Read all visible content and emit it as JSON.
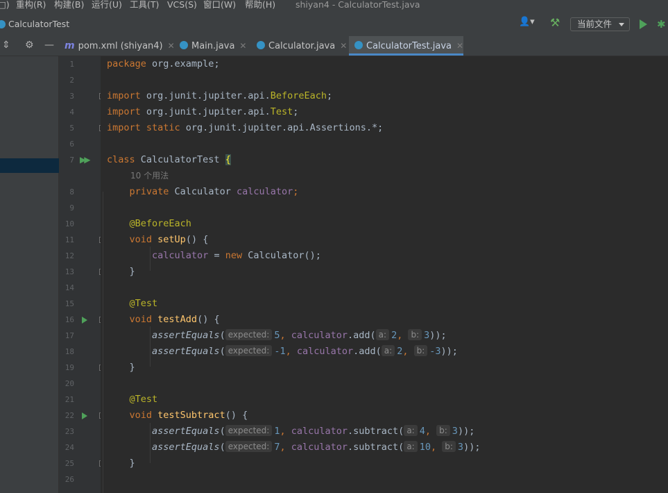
{
  "menubar": {
    "items": [
      "□)",
      "重构(R)",
      "构建(B)",
      "运行(U)",
      "工具(T)",
      "VCS(S)",
      "窗口(W)",
      "帮助(H)"
    ],
    "window_title": "shiyan4 - CalculatorTest.java"
  },
  "navbar": {
    "breadcrumb": "CalculatorTest",
    "run_config": "当前文件"
  },
  "tabs": [
    {
      "label": "pom.xml (shiyan4)",
      "icon": "maven-icon"
    },
    {
      "label": "Main.java",
      "icon": "java-class-icon"
    },
    {
      "label": "Calculator.java",
      "icon": "java-class-icon"
    },
    {
      "label": "CalculatorTest.java",
      "icon": "java-class-icon",
      "active": true
    }
  ],
  "gutter": {
    "line_numbers": [
      "1",
      "2",
      "3",
      "4",
      "5",
      "6",
      "7",
      "8",
      "9",
      "10",
      "11",
      "12",
      "13",
      "14",
      "15",
      "16",
      "17",
      "18",
      "19",
      "20",
      "21",
      "22",
      "23",
      "24",
      "25",
      "26"
    ]
  },
  "code": {
    "l1_kw": "package",
    "l1_rest": " org.example;",
    "l3_kw": "import",
    "l3_a": " org.junit.jupiter.api.",
    "l3_b": "BeforeEach",
    "l3_c": ";",
    "l4_kw": "import",
    "l4_a": " org.junit.jupiter.api.",
    "l4_b": "Test",
    "l4_c": ";",
    "l5_kw": "import static",
    "l5_a": " org.junit.jupiter.api.Assertions.*;",
    "l7_kw": "class",
    "l7_name": " CalculatorTest ",
    "l7_brace": "{",
    "usages": "10 个用法",
    "l8_kw": "private",
    "l8_type": " Calculator ",
    "l8_field": "calculator",
    "l8_end": ";",
    "l10_ann": "@BeforeEach",
    "l11_kw": "void",
    "l11_fn": " setUp",
    "l11_end": "() {",
    "l12_field": "calculator",
    "l12_eq": " = ",
    "l12_kw": "new",
    "l12_rest": " Calculator();",
    "l13": "}",
    "l15_ann": "@Test",
    "l16_kw": "void",
    "l16_fn": " testAdd",
    "l16_end": "() {",
    "l17_fn": "assertEquals",
    "l17_p": "(",
    "hint_expected": "expected:",
    "l17_v1": "5",
    "l17_c": ", ",
    "l17_field": "calculator",
    "l17_m": ".add(",
    "hint_a": "a:",
    "l17_a": "2",
    "l17_sep": ", ",
    "hint_b": "b:",
    "l17_b": "3",
    "l17_end": "));",
    "l18_v1": "-1",
    "l18_a": "2",
    "l18_b": "-3",
    "l19": "}",
    "l21_ann": "@Test",
    "l22_kw": "void",
    "l22_fn": " testSubtract",
    "l22_end": "() {",
    "l23_m": ".subtract(",
    "l23_v1": "1",
    "l23_a": "4",
    "l23_b": "3",
    "l24_v1": "7",
    "l24_a": "10",
    "l24_b": "3",
    "l25": "}"
  },
  "colors": {
    "keyword": "#cc7832",
    "annotation": "#bbb529",
    "field": "#9876aa",
    "number": "#6897bb",
    "function": "#ffc66d",
    "accent": "#4a88c7"
  }
}
